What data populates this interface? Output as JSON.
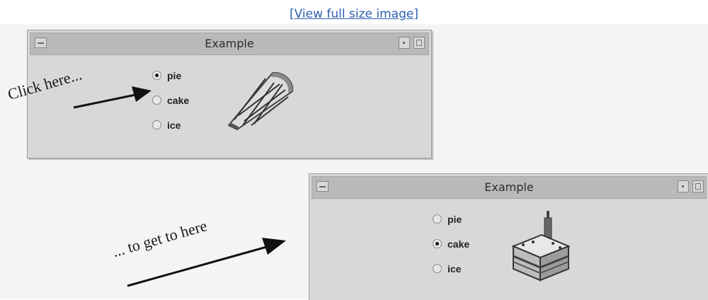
{
  "link": {
    "text": "[View full size image]"
  },
  "windows": [
    {
      "title": "Example",
      "options": [
        {
          "label": "pie",
          "checked": true
        },
        {
          "label": "cake",
          "checked": false
        },
        {
          "label": "ice",
          "checked": false
        }
      ],
      "image": "pie-slice"
    },
    {
      "title": "Example",
      "options": [
        {
          "label": "pie",
          "checked": false
        },
        {
          "label": "cake",
          "checked": true
        },
        {
          "label": "ice",
          "checked": false
        }
      ],
      "image": "cake-slice"
    }
  ],
  "annotations": {
    "first": "Click here...",
    "second": "... to get to here"
  }
}
